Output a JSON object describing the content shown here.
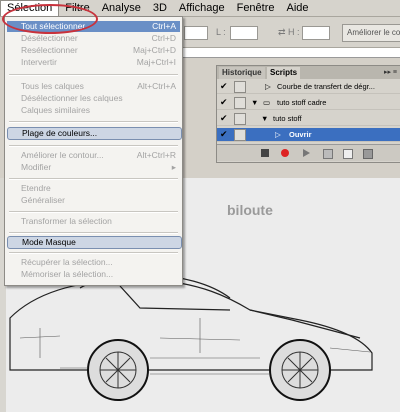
{
  "menubar": {
    "items": [
      "Sélection",
      "Filtre",
      "Analyse",
      "3D",
      "Affichage",
      "Fenêtre",
      "Aide"
    ]
  },
  "options_bar": {
    "label_l": "L :",
    "label_h": "H :",
    "refine_button": "Améliorer le co"
  },
  "selection_menu": {
    "items": [
      {
        "label": "Tout sélectionner",
        "shortcut": "Ctrl+A"
      },
      {
        "label": "Désélectionner",
        "shortcut": "Ctrl+D"
      },
      {
        "label": "Resélectionner",
        "shortcut": "Maj+Ctrl+D"
      },
      {
        "label": "Intervertir",
        "shortcut": "Maj+Ctrl+I"
      },
      {
        "label": "Tous les calques",
        "shortcut": "Alt+Ctrl+A"
      },
      {
        "label": "Désélectionner les calques",
        "shortcut": ""
      },
      {
        "label": "Calques similaires",
        "shortcut": ""
      },
      {
        "label": "Plage de couleurs...",
        "shortcut": ""
      },
      {
        "label": "Améliorer le contour...",
        "shortcut": "Alt+Ctrl+R"
      },
      {
        "label": "Modifier",
        "shortcut": "▸"
      },
      {
        "label": "Etendre",
        "shortcut": ""
      },
      {
        "label": "Généraliser",
        "shortcut": ""
      },
      {
        "label": "Transformer la sélection",
        "shortcut": ""
      },
      {
        "label": "Mode Masque",
        "shortcut": ""
      },
      {
        "label": "Récupérer la sélection...",
        "shortcut": ""
      },
      {
        "label": "Mémoriser la sélection...",
        "shortcut": ""
      }
    ]
  },
  "panel": {
    "tabs": [
      "Historique",
      "Scripts"
    ],
    "menu_glyph": "▸▸ ≡",
    "rows": [
      {
        "label": "Courbe de transfert de dégr..."
      },
      {
        "label": "tuto stoff cadre"
      },
      {
        "label": "tuto stoff"
      },
      {
        "label": "Ouvrir"
      }
    ]
  },
  "canvas": {
    "watermark": "biloute"
  },
  "colors": {
    "highlight": "#3b6fc0",
    "annotation_circle": "#c8323c",
    "menu_bg": "#f4f3f0"
  }
}
